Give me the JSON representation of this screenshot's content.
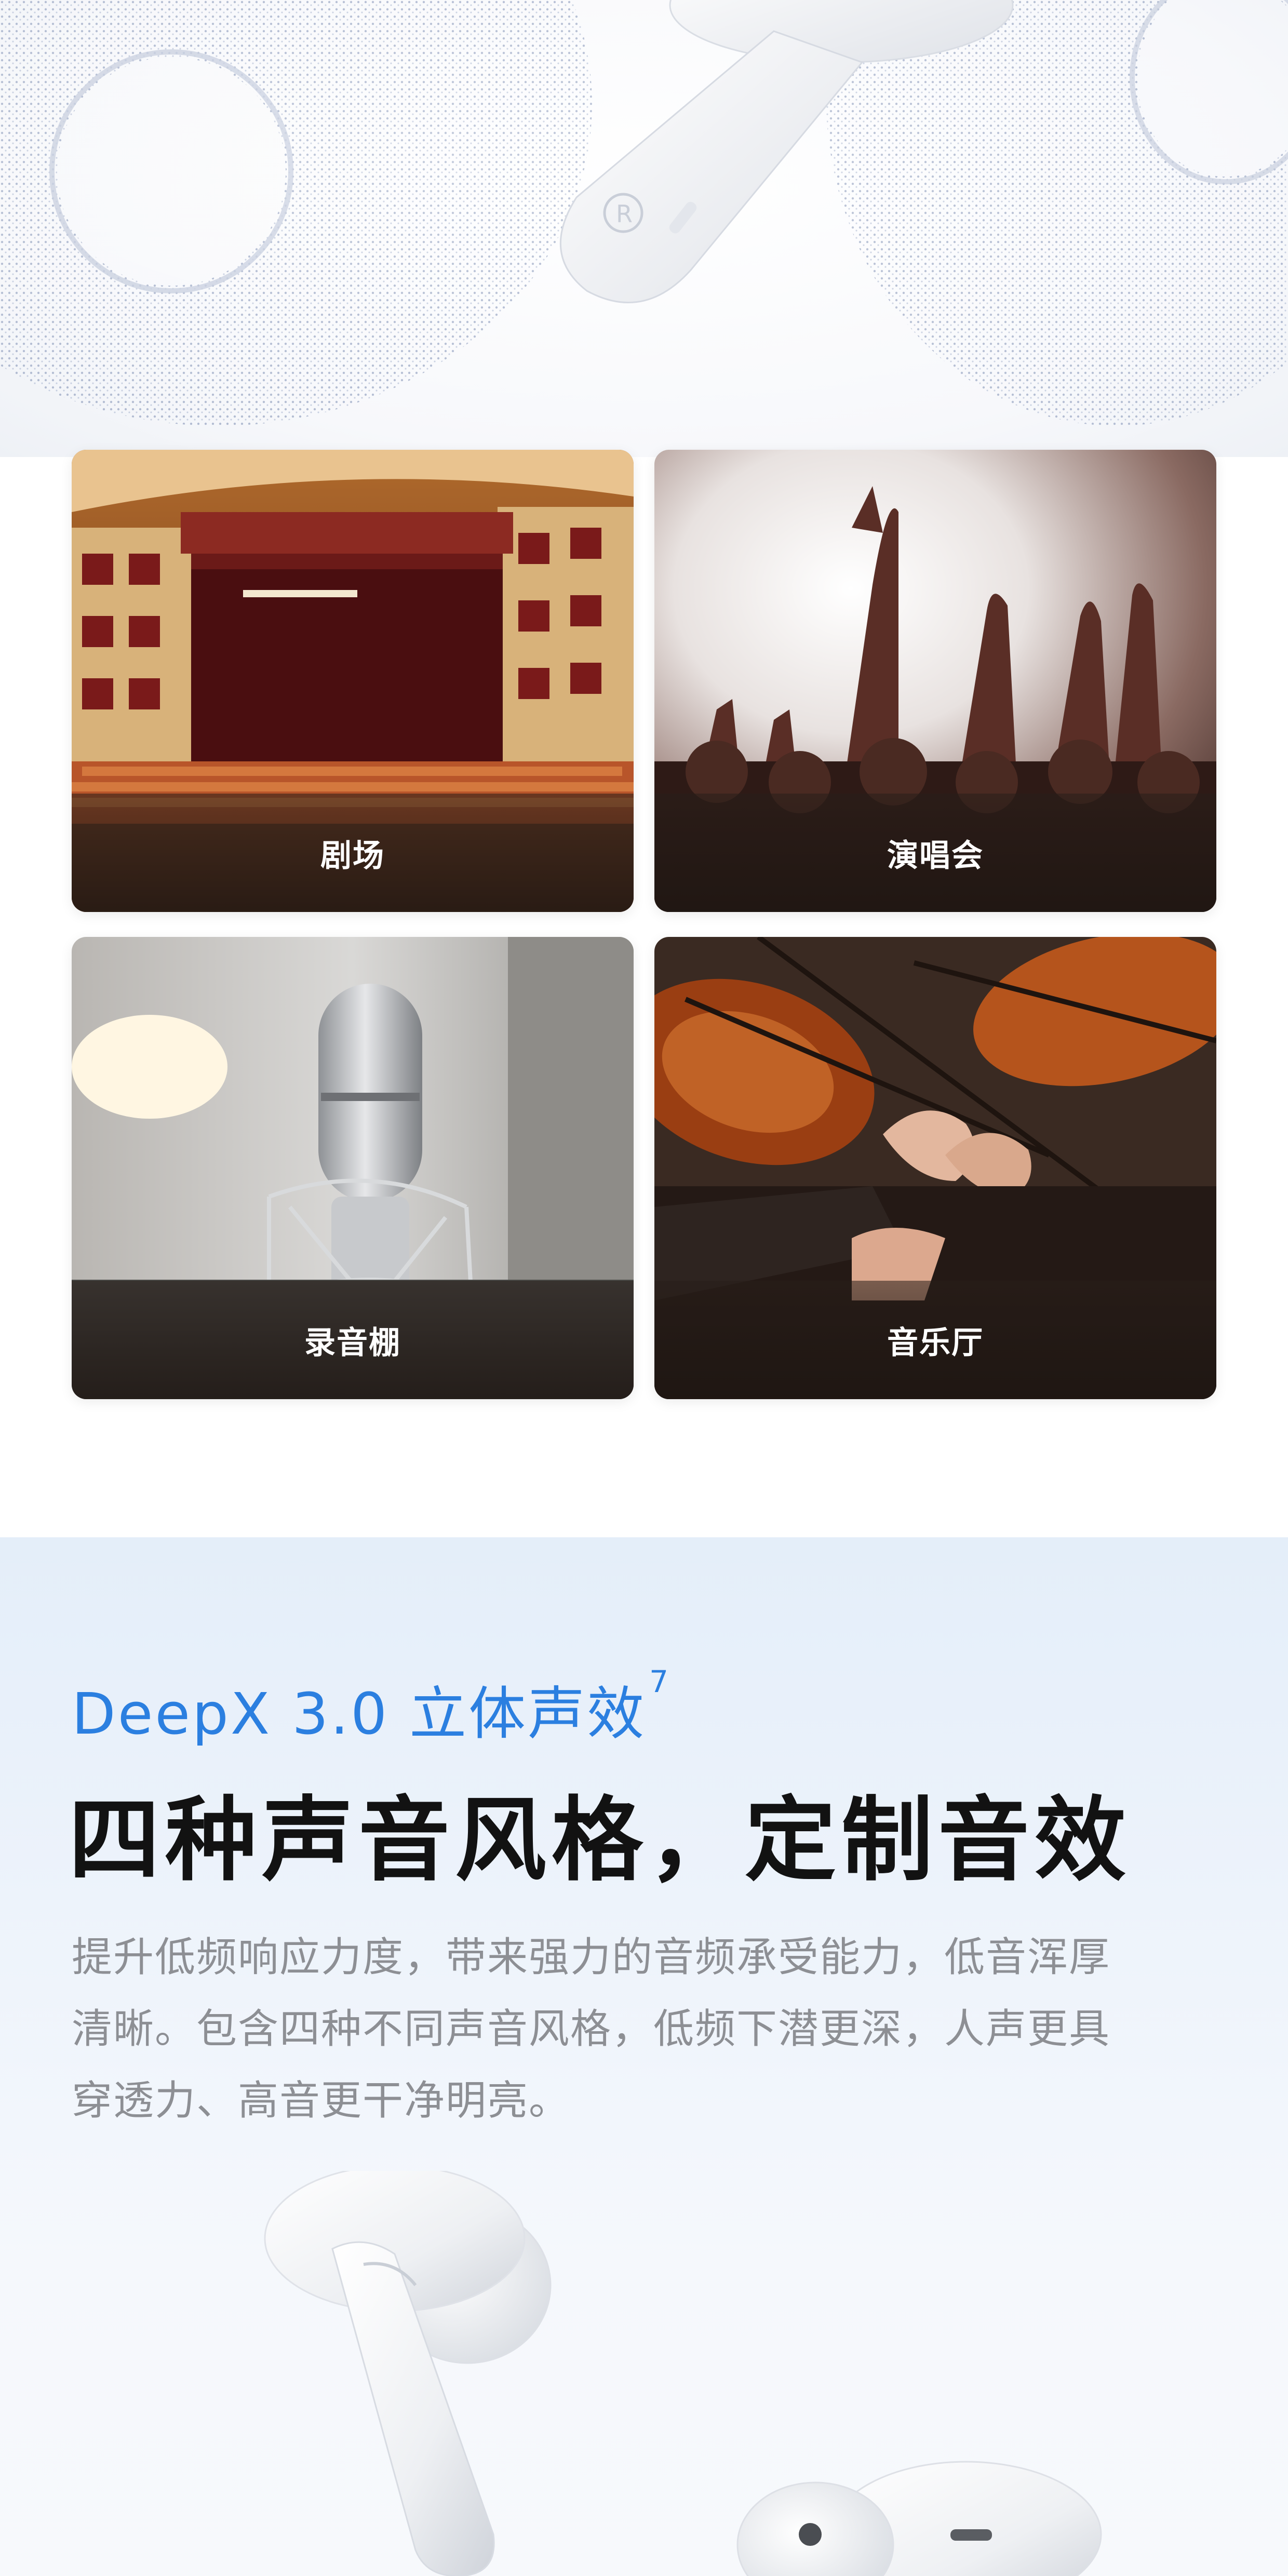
{
  "hero": {
    "product_image": "earbud-stem-image",
    "particle_pattern": "dotted-sound-field"
  },
  "scenes": [
    {
      "label": "剧场",
      "image": "theatre-image"
    },
    {
      "label": "演唱会",
      "image": "concert-image"
    },
    {
      "label": "录音棚",
      "image": "studio-microphone-image"
    },
    {
      "label": "音乐厅",
      "image": "concert-hall-violin-image"
    }
  ],
  "sound_section": {
    "eyebrow": "DeepX 3.0 立体声效",
    "eyebrow_footnote": "7",
    "headline": "四种声音风格，定制音效",
    "body_lines": [
      "提升低频响应力度，带来强力的音频承受能力，低音浑厚",
      "清晰。包含四种不同声音风格，低频下潜更深，人声更具",
      "穿透力、高音更干净明亮。"
    ],
    "product_image": "white-earbuds-image"
  },
  "colors": {
    "accent": "#2b7fe0",
    "headline": "#121212",
    "body_text": "#8d8f94",
    "section_bg": "#e9f1fa"
  }
}
